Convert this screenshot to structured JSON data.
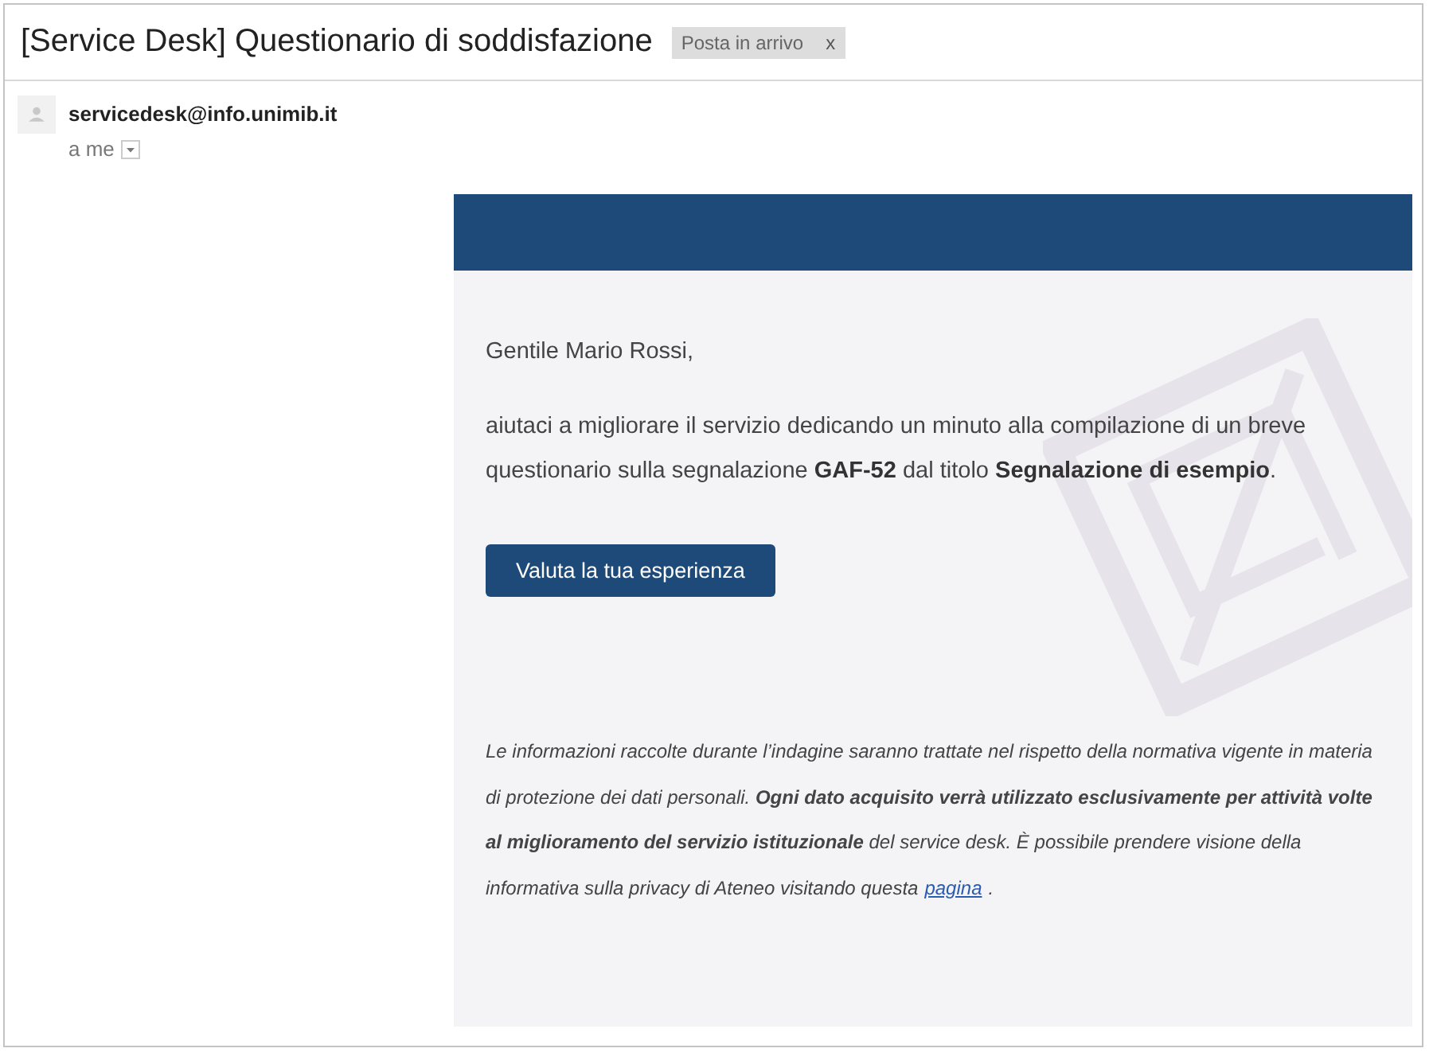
{
  "email": {
    "subject": "[Service Desk] Questionario di soddisfazione",
    "labels": [
      {
        "text": "Posta in arrivo",
        "remove": "x"
      }
    ],
    "sender": "servicedesk@info.unimib.it",
    "recipient": "a me"
  },
  "message": {
    "greeting": "Gentile Mario Rossi,",
    "body": "aiutaci a migliorare il servizio dedicando un minuto alla compilazione di un breve questionario sulla segnalazione **GAF-52** dal titolo **Segnalazione di esempio**.",
    "button": "Valuta la tua esperienza",
    "privacy": {
      "text": "Le informazioni raccolte durante l’indagine saranno trattate nel rispetto della normativa vigente in materia di protezione dei dati personali. **Ogni dato acquisito verrà utilizzato esclusivamente per attività volte al miglioramento del servizio istituzionale** del service desk. È possibile prendere visione della informativa sulla privacy di Ateneo visitando questa",
      "link": "pagina",
      "after": "."
    }
  }
}
